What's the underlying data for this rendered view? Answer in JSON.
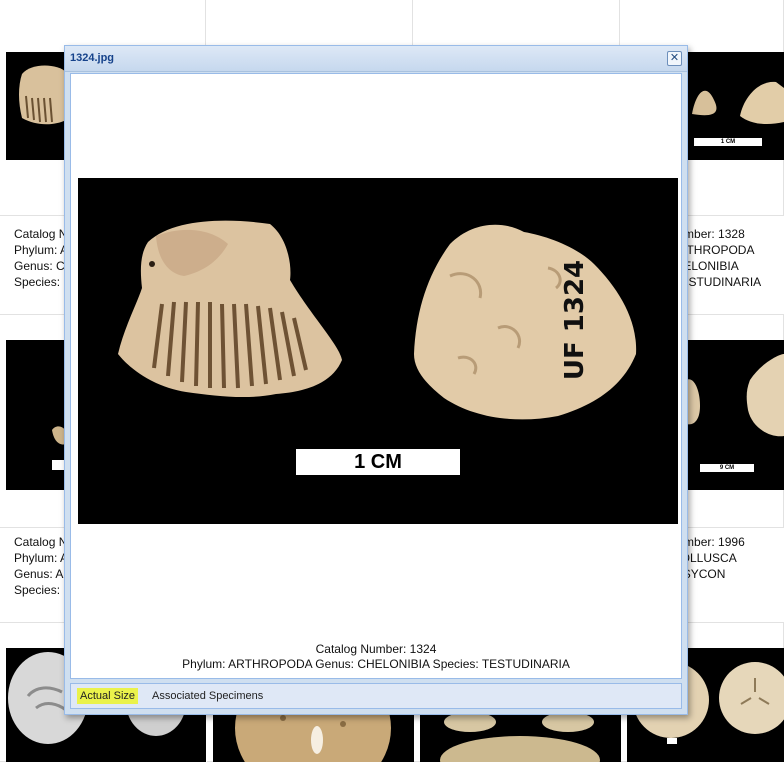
{
  "gallery": {
    "right_top": {
      "scale_label": "1 CM",
      "lines": [
        "Catalog Number: 1328",
        "Phylum: ARTHROPODA",
        "Genus: CHELONIBIA",
        "Species: TESTUDINARIA"
      ]
    },
    "right_mid": {
      "scale_label": "9 CM",
      "lines": [
        "Catalog Number: 1996",
        "Phylum: MOLLUSCA",
        "Genus: BUSYCON"
      ]
    },
    "left_top": {
      "lines": [
        "Catalog N",
        "Phylum: A",
        "Genus: C",
        "Species:"
      ]
    },
    "left_mid": {
      "lines": [
        "Catalog N",
        "Phylum: A",
        "Genus: A",
        "Species:"
      ]
    }
  },
  "modal": {
    "title": "1324.jpg",
    "close_glyph": "✕",
    "image_scale_label": "1 CM",
    "specimen_tag": "UF 1324",
    "caption_line1": "Catalog Number: 1324",
    "caption_line2": "Phylum: ARTHROPODA Genus: CHELONIBIA Species: TESTUDINARIA",
    "buttons": {
      "actual_size": "Actual Size",
      "associated": "Associated Specimens"
    }
  },
  "colors": {
    "header_text": "#15428b",
    "window_border": "#99bbe8",
    "highlight": "#eaf24b",
    "shell": "#e8d4b4"
  }
}
